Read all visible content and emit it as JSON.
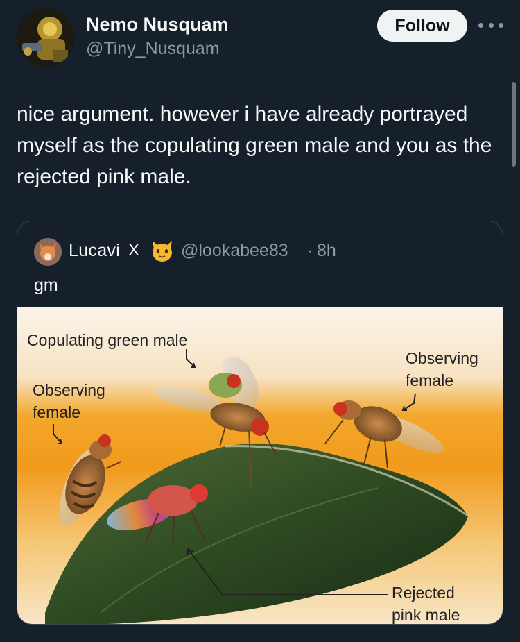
{
  "author": {
    "name": "Nemo Nusquam",
    "handle": "@Tiny_Nusquam",
    "avatar_icon": "robot-avatar-icon"
  },
  "follow_label": "Follow",
  "tweet_text": "nice argument. however i have already portrayed myself as the copulating green male and you as the rejected pink male.",
  "quote": {
    "name": "Lucavi",
    "verified_mark": "X",
    "emoji_icon": "cat-emoji-icon",
    "handle": "@lookabee83",
    "separator": "·",
    "time": "8h",
    "text": "gm",
    "image_labels": {
      "copulating_green_male": "Copulating green male",
      "observing_female_left_line1": "Observing",
      "observing_female_left_line2": "female",
      "observing_female_right_line1": "Observing",
      "observing_female_right_line2": "female",
      "rejected_pink_male_line1": "Rejected",
      "rejected_pink_male_line2": "pink male"
    }
  },
  "colors": {
    "background": "#15202b",
    "text": "#f7f9f9",
    "secondary": "#8b98a5",
    "border": "#38444d",
    "follow_bg": "#eff3f4"
  }
}
